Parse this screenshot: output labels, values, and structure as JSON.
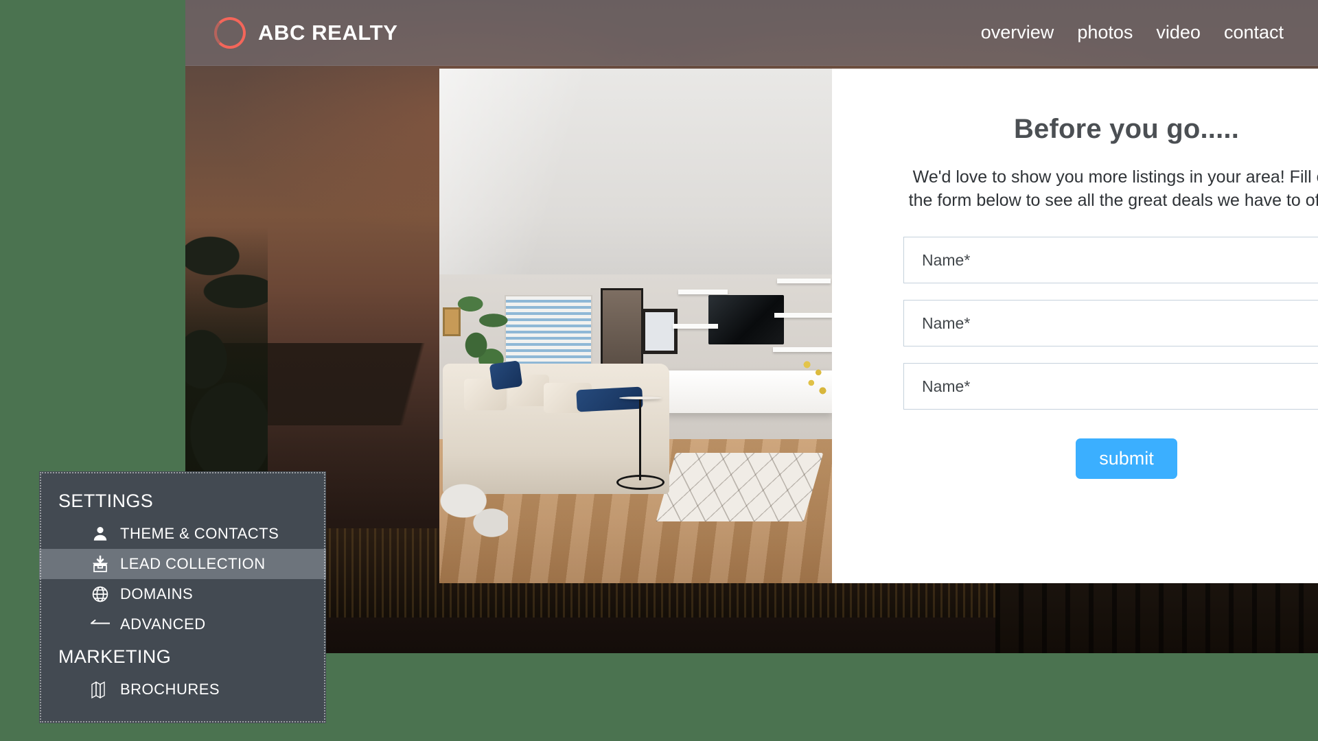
{
  "site": {
    "brand": {
      "name": "ABC REALTY",
      "mark_color": "#f4665a"
    },
    "nav": [
      {
        "label": "overview"
      },
      {
        "label": "photos"
      },
      {
        "label": "video"
      },
      {
        "label": "contact"
      }
    ]
  },
  "modal": {
    "title": "Before you go.....",
    "subtitle": "We'd love to show you more listings in your area! Fill out the form below to see all the great deals we have to offer!",
    "fields": [
      {
        "placeholder": "Name*",
        "value": ""
      },
      {
        "placeholder": "Name*",
        "value": ""
      },
      {
        "placeholder": "Name*",
        "value": ""
      }
    ],
    "submit_label": "submit",
    "submit_color": "#3bafff",
    "photo_alt": "living-room-interior-photo"
  },
  "settings_panel": {
    "sections": [
      {
        "title": "SETTINGS",
        "items": [
          {
            "label": "THEME & CONTACTS",
            "icon": "person-icon",
            "active": false
          },
          {
            "label": "LEAD COLLECTION",
            "icon": "inbox-box-icon",
            "active": true
          },
          {
            "label": "DOMAINS",
            "icon": "globe-icon",
            "active": false
          },
          {
            "label": "ADVANCED",
            "icon": "arrow-left-icon",
            "active": false
          }
        ]
      },
      {
        "title": "MARKETING",
        "items": [
          {
            "label": "BROCHURES",
            "icon": "brochure-map-icon",
            "active": false
          }
        ]
      }
    ],
    "active_color": "#6d747c",
    "panel_color": "#434a52"
  },
  "page": {
    "background_color": "#4b7350"
  }
}
